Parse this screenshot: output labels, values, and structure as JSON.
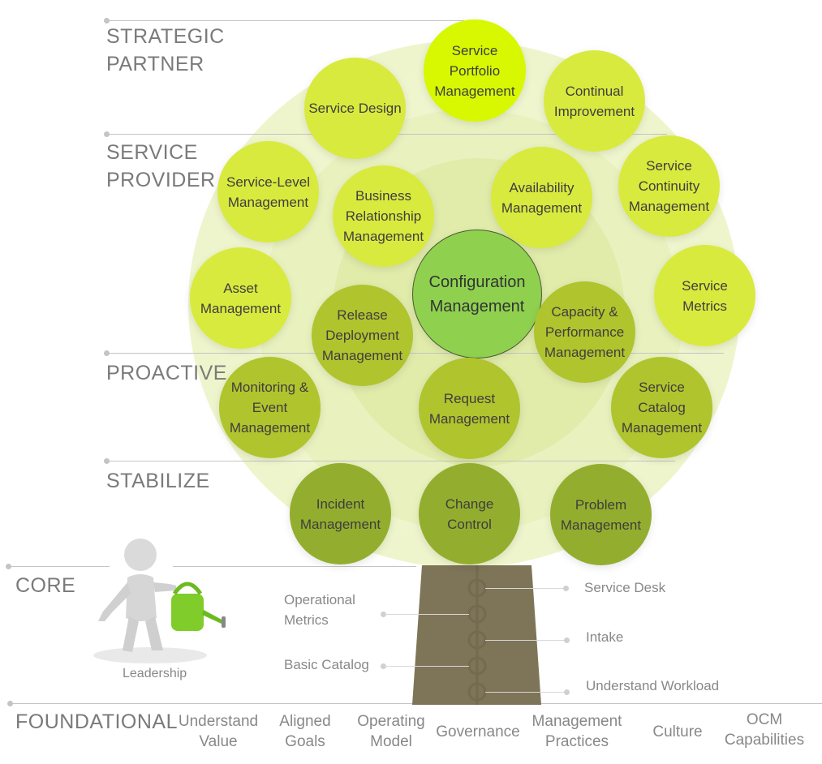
{
  "tiers": [
    {
      "id": "strategic-partner",
      "label": "STRATEGIC\nPARTNER"
    },
    {
      "id": "service-provider",
      "label": "SERVICE\nPROVIDER"
    },
    {
      "id": "proactive",
      "label": "PROACTIVE"
    },
    {
      "id": "stabilize",
      "label": "STABILIZE"
    },
    {
      "id": "core",
      "label": "CORE"
    },
    {
      "id": "foundational",
      "label": "FOUNDATIONAL"
    }
  ],
  "bubbles": [
    {
      "id": "service-portfolio-management",
      "label": "Service\nPortfolio\nManagement",
      "tier": "strategic-partner",
      "color": "#d7f800"
    },
    {
      "id": "service-design",
      "label": "Service Design",
      "tier": "strategic-partner",
      "color": "#d9ea3e"
    },
    {
      "id": "continual-improvement",
      "label": "Continual\nImprovement",
      "tier": "strategic-partner",
      "color": "#d9ea3e"
    },
    {
      "id": "service-level-management",
      "label": "Service-Level\nManagement",
      "tier": "service-provider",
      "color": "#d9ea3e"
    },
    {
      "id": "business-relationship-management",
      "label": "Business\nRelationship\nManagement",
      "tier": "service-provider",
      "color": "#d9ea3e"
    },
    {
      "id": "availability-management",
      "label": "Availability\nManagement",
      "tier": "service-provider",
      "color": "#d9ea3e"
    },
    {
      "id": "service-continuity-management",
      "label": "Service\nContinuity\nManagement",
      "tier": "service-provider",
      "color": "#d9ea3e"
    },
    {
      "id": "asset-management",
      "label": "Asset\nManagement",
      "tier": "service-provider",
      "color": "#d9ea3e"
    },
    {
      "id": "service-metrics",
      "label": "Service\nMetrics",
      "tier": "service-provider",
      "color": "#d9ea3e"
    },
    {
      "id": "configuration-management",
      "label": "Configuration\nManagement",
      "tier": "center",
      "color": "#8fd14f"
    },
    {
      "id": "release-deployment-management",
      "label": "Release\nDeployment\nManagement",
      "tier": "proactive",
      "color": "#b0c42e"
    },
    {
      "id": "capacity-performance-management",
      "label": "Capacity &\nPerformance\nManagement",
      "tier": "proactive",
      "color": "#b0c42e"
    },
    {
      "id": "monitoring-event-management",
      "label": "Monitoring &\nEvent\nManagement",
      "tier": "proactive",
      "color": "#b0c42e"
    },
    {
      "id": "request-management",
      "label": "Request\nManagement",
      "tier": "proactive",
      "color": "#b0c42e"
    },
    {
      "id": "service-catalog-management",
      "label": "Service\nCatalog\nManagement",
      "tier": "proactive",
      "color": "#b0c42e"
    },
    {
      "id": "incident-management",
      "label": "Incident\nManagement",
      "tier": "stabilize",
      "color": "#93ae2e"
    },
    {
      "id": "change-control",
      "label": "Change\nControl",
      "tier": "stabilize",
      "color": "#93ae2e"
    },
    {
      "id": "problem-management",
      "label": "Problem\nManagement",
      "tier": "stabilize",
      "color": "#93ae2e"
    }
  ],
  "core": {
    "left_items": [
      "Operational\nMetrics",
      "Basic Catalog"
    ],
    "right_items": [
      "Service Desk",
      "Intake",
      "Understand Workload"
    ],
    "figure_caption": "Leadership"
  },
  "foundational_items": [
    "Understand\nValue",
    "Aligned\nGoals",
    "Operating\nModel",
    "Governance",
    "Management\nPractices",
    "Culture",
    "OCM\nCapabilities"
  ],
  "colors": {
    "trunk": "#7e7458",
    "tier_text": "#7a7a7a",
    "line": "#c4c4c4",
    "canopy_outer": "#f1f7d2",
    "canopy_mid": "#e9f2bf",
    "canopy_inner": "#dfeaa4"
  }
}
